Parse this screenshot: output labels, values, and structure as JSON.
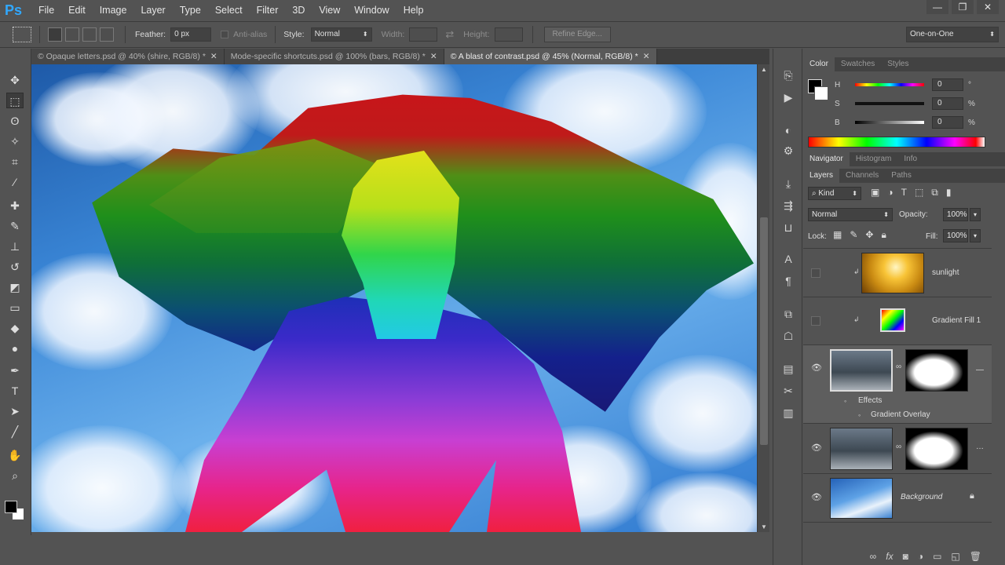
{
  "app": {
    "logo": "Ps"
  },
  "menu": [
    "File",
    "Edit",
    "Image",
    "Layer",
    "Type",
    "Select",
    "Filter",
    "3D",
    "View",
    "Window",
    "Help"
  ],
  "window_controls": {
    "minimize": "—",
    "restore": "❐",
    "close": "✕"
  },
  "options": {
    "feather_label": "Feather:",
    "feather_value": "0 px",
    "antialias_label": "Anti-alias",
    "style_label": "Style:",
    "style_value": "Normal",
    "width_label": "Width:",
    "height_label": "Height:",
    "refine_edge": "Refine Edge...",
    "workspace": "One-on-One"
  },
  "tabs": [
    {
      "label": "© Opaque letters.psd @ 40% (shire, RGB/8) *",
      "close": "✕"
    },
    {
      "label": "Mode-specific shortcuts.psd @ 100% (bars, RGB/8) *",
      "close": "✕"
    },
    {
      "label": "© A blast of contrast.psd @ 45% (Normal, RGB/8) *",
      "close": "✕"
    }
  ],
  "color_panel": {
    "tabs": [
      "Color",
      "Swatches",
      "Styles"
    ],
    "h_label": "H",
    "h_value": "0",
    "h_unit": "°",
    "s_label": "S",
    "s_value": "0",
    "s_unit": "%",
    "b_label": "B",
    "b_value": "0",
    "b_unit": "%"
  },
  "nav_tabs": [
    "Navigator",
    "Histogram",
    "Info"
  ],
  "layers_panel": {
    "tabs": [
      "Layers",
      "Channels",
      "Paths"
    ],
    "kind_label": "Kind",
    "blend_mode": "Normal",
    "opacity_label": "Opacity:",
    "opacity_value": "100%",
    "lock_label": "Lock:",
    "fill_label": "Fill:",
    "fill_value": "100%",
    "layers": [
      {
        "name": "sunlight",
        "visible": false
      },
      {
        "name": "Gradient Fill 1",
        "visible": false
      },
      {
        "name": "",
        "visible": true,
        "effects_label": "Effects",
        "effect_item": "Gradient Overlay"
      },
      {
        "name": "",
        "visible": true
      },
      {
        "name": "Background",
        "visible": true
      }
    ]
  },
  "colors": {
    "ui_bg": "#535353",
    "accent": "#31a8ff",
    "foreground": "#000000",
    "background": "#ffffff"
  }
}
